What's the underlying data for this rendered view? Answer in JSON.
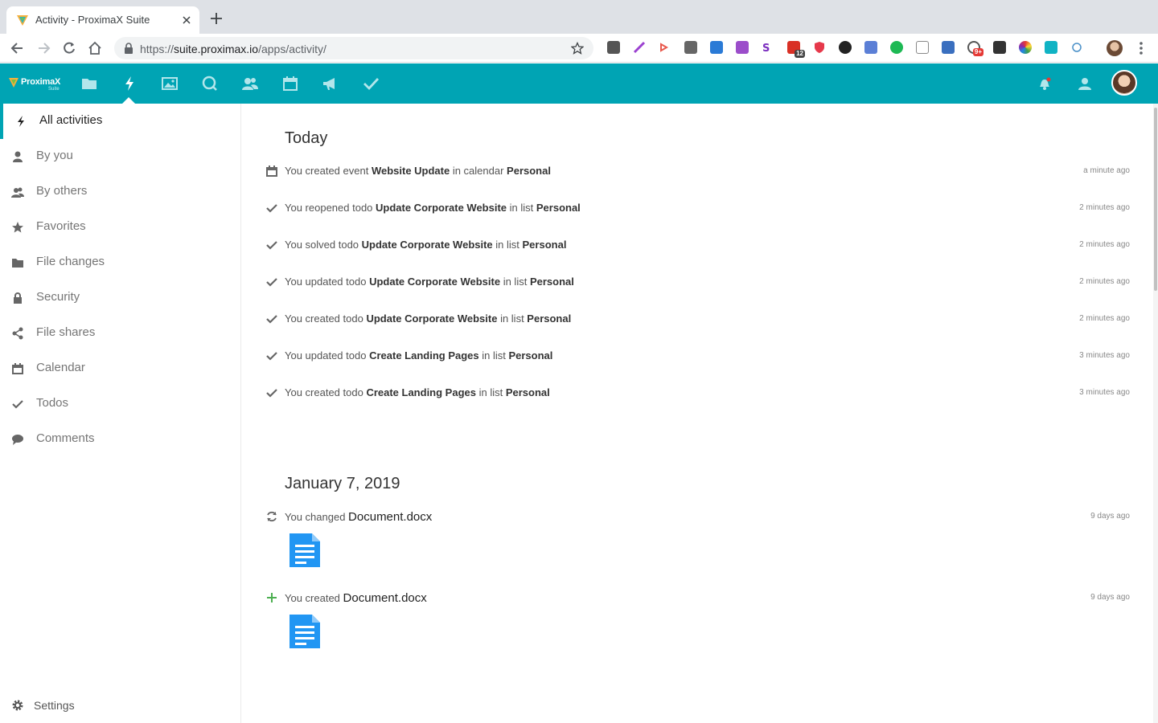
{
  "browser": {
    "tab_title": "Activity - ProximaX Suite",
    "url_prefix": "https://",
    "url_host": "suite.proximax.io",
    "url_path": "/apps/activity/",
    "ext_badges": [
      "12",
      "9+"
    ]
  },
  "app": {
    "logo_text": "ProximaX",
    "logo_sub": "Suite",
    "accent": "#00a4b4",
    "nav_icons": [
      "files-icon",
      "activity-icon",
      "gallery-icon",
      "search-icon",
      "contacts-icon",
      "calendar-icon",
      "announcements-icon",
      "tasks-icon"
    ]
  },
  "sidebar": {
    "items": [
      {
        "label": "All activities",
        "icon": "lightning-icon",
        "active": true
      },
      {
        "label": "By you",
        "icon": "user-icon"
      },
      {
        "label": "By others",
        "icon": "users-icon"
      },
      {
        "label": "Favorites",
        "icon": "star-icon"
      },
      {
        "label": "File changes",
        "icon": "folder-icon"
      },
      {
        "label": "Security",
        "icon": "lock-icon"
      },
      {
        "label": "File shares",
        "icon": "share-icon"
      },
      {
        "label": "Calendar",
        "icon": "calendar-icon"
      },
      {
        "label": "Todos",
        "icon": "check-icon"
      },
      {
        "label": "Comments",
        "icon": "comment-icon"
      }
    ],
    "settings_label": "Settings"
  },
  "sections": [
    {
      "title": "Today",
      "activities": [
        {
          "icon": "calendar-icon",
          "pre": "You created event ",
          "obj": "Website Update",
          "mid": " in calendar ",
          "target": "Personal",
          "time": "a minute ago"
        },
        {
          "icon": "check-icon",
          "pre": "You reopened todo ",
          "obj": "Update Corporate Website",
          "mid": " in list ",
          "target": "Personal",
          "time": "2 minutes ago"
        },
        {
          "icon": "check-icon",
          "pre": "You solved todo ",
          "obj": "Update Corporate Website",
          "mid": " in list ",
          "target": "Personal",
          "time": "2 minutes ago"
        },
        {
          "icon": "check-icon",
          "pre": "You updated todo ",
          "obj": "Update Corporate Website",
          "mid": " in list ",
          "target": "Personal",
          "time": "2 minutes ago"
        },
        {
          "icon": "check-icon",
          "pre": "You created todo ",
          "obj": "Update Corporate Website",
          "mid": " in list ",
          "target": "Personal",
          "time": "2 minutes ago"
        },
        {
          "icon": "check-icon",
          "pre": "You updated todo ",
          "obj": "Create Landing Pages",
          "mid": " in list ",
          "target": "Personal",
          "time": "3 minutes ago"
        },
        {
          "icon": "check-icon",
          "pre": "You created todo ",
          "obj": "Create Landing Pages",
          "mid": " in list ",
          "target": "Personal",
          "time": "3 minutes ago"
        }
      ]
    },
    {
      "title": "January 7, 2019",
      "activities": [
        {
          "icon": "refresh-icon",
          "pre": "You changed ",
          "file": "Document.docx",
          "time": "9 days ago"
        },
        {
          "icon": "plus-icon",
          "pre": "You created ",
          "file": "Document.docx",
          "time": "9 days ago"
        }
      ]
    }
  ]
}
